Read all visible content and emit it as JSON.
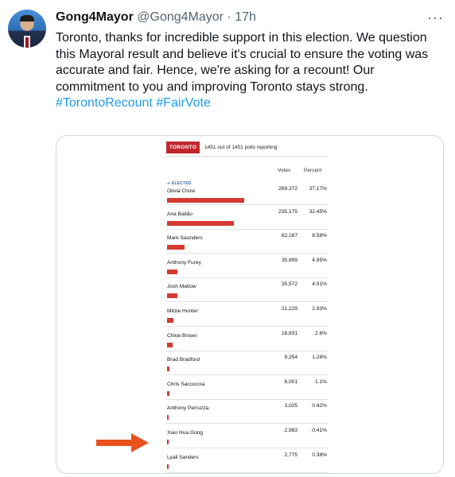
{
  "tweet": {
    "author_name": "Gong4Mayor",
    "handle": "@Gong4Mayor",
    "separator": "·",
    "time": "17h",
    "more_icon": "···",
    "text_main": "Toronto, thanks for incredible support in this election. We question this Mayoral result and believe it's crucial to ensure the voting was accurate and fair. Hence, we're asking for a recount! Our commitment to you and improving Toronto stays strong.",
    "hashtags": [
      "#TorontoRecount",
      "#FairVote"
    ],
    "accent_color": "#1d9bf0"
  },
  "results": {
    "city": "TORONTO",
    "polls_reporting": "1451 out of 1451 polls reporting",
    "col_votes": "Votes",
    "col_percent": "Percent",
    "elected_label": "✔ ELECTED",
    "bar_color": "#d63a2f",
    "candidates": [
      {
        "name": "Olivia Chow",
        "votes": "269,372",
        "percent": "37.17%",
        "share": 37.17,
        "elected": true
      },
      {
        "name": "Ana Bailão",
        "votes": "235,175",
        "percent": "32.45%",
        "share": 32.45
      },
      {
        "name": "Mark Saunders",
        "votes": "62,167",
        "percent": "8.58%",
        "share": 8.58
      },
      {
        "name": "Anthony Furey",
        "votes": "35,899",
        "percent": "4.95%",
        "share": 4.95
      },
      {
        "name": "Josh Matlow",
        "votes": "35,572",
        "percent": "4.91%",
        "share": 4.91
      },
      {
        "name": "Mitzie Hunter",
        "votes": "21,229",
        "percent": "2.93%",
        "share": 2.93
      },
      {
        "name": "Chloe Brown",
        "votes": "18,831",
        "percent": "2.6%",
        "share": 2.6
      },
      {
        "name": "Brad Bradford",
        "votes": "9,254",
        "percent": "1.28%",
        "share": 1.28
      },
      {
        "name": "Chris Saccoccia",
        "votes": "8,001",
        "percent": "1.1%",
        "share": 1.1
      },
      {
        "name": "Anthony Perruzza",
        "votes": "3,025",
        "percent": "0.42%",
        "share": 0.42
      },
      {
        "name": "Xiao Hua Gong",
        "votes": "2,983",
        "percent": "0.41%",
        "share": 0.41,
        "highlighted": true
      },
      {
        "name": "Lyall Sanders",
        "votes": "2,775",
        "percent": "0.38%",
        "share": 0.38
      }
    ]
  },
  "annotation": {
    "arrow_color": "#e8501e",
    "arrow_icon": "right-arrow-icon"
  }
}
